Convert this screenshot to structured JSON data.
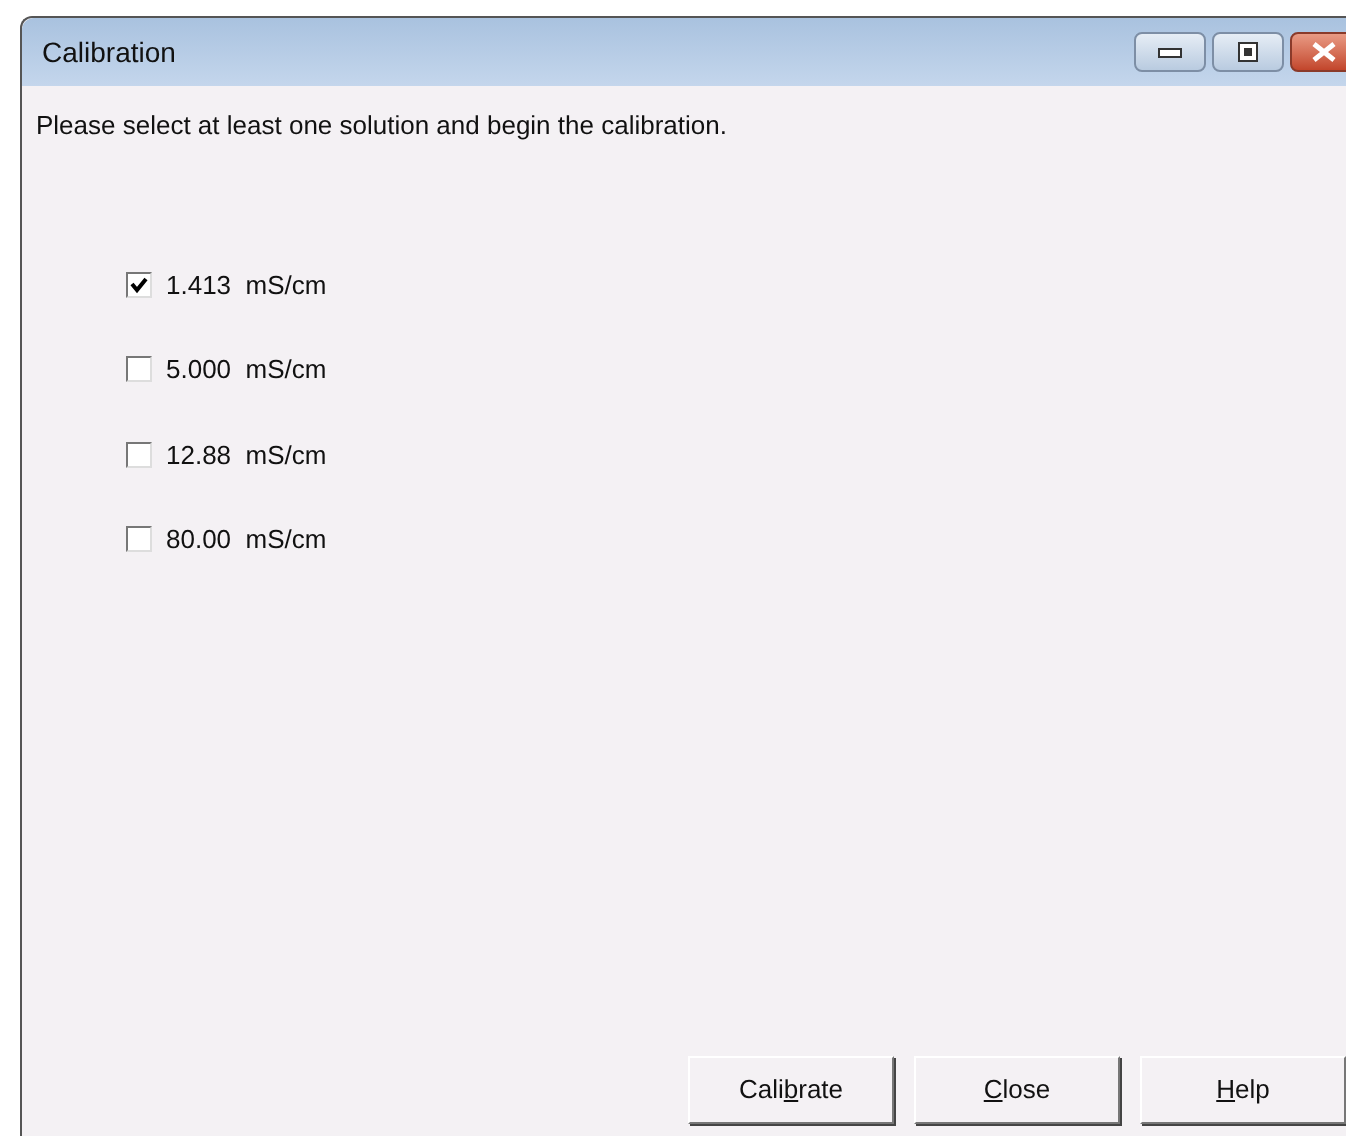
{
  "window": {
    "title": "Calibration"
  },
  "instruction": "Please select at least one solution and begin the calibration.",
  "solutions": [
    {
      "label": "1.413  mS/cm",
      "checked": true
    },
    {
      "label": "5.000  mS/cm",
      "checked": false
    },
    {
      "label": "12.88  mS/cm",
      "checked": false
    },
    {
      "label": "80.00  mS/cm",
      "checked": false
    }
  ],
  "buttons": [
    {
      "before": "Cali",
      "key": "b",
      "after": "rate"
    },
    {
      "key": "C",
      "after": "lose"
    },
    {
      "key": "H",
      "after": "elp"
    }
  ]
}
